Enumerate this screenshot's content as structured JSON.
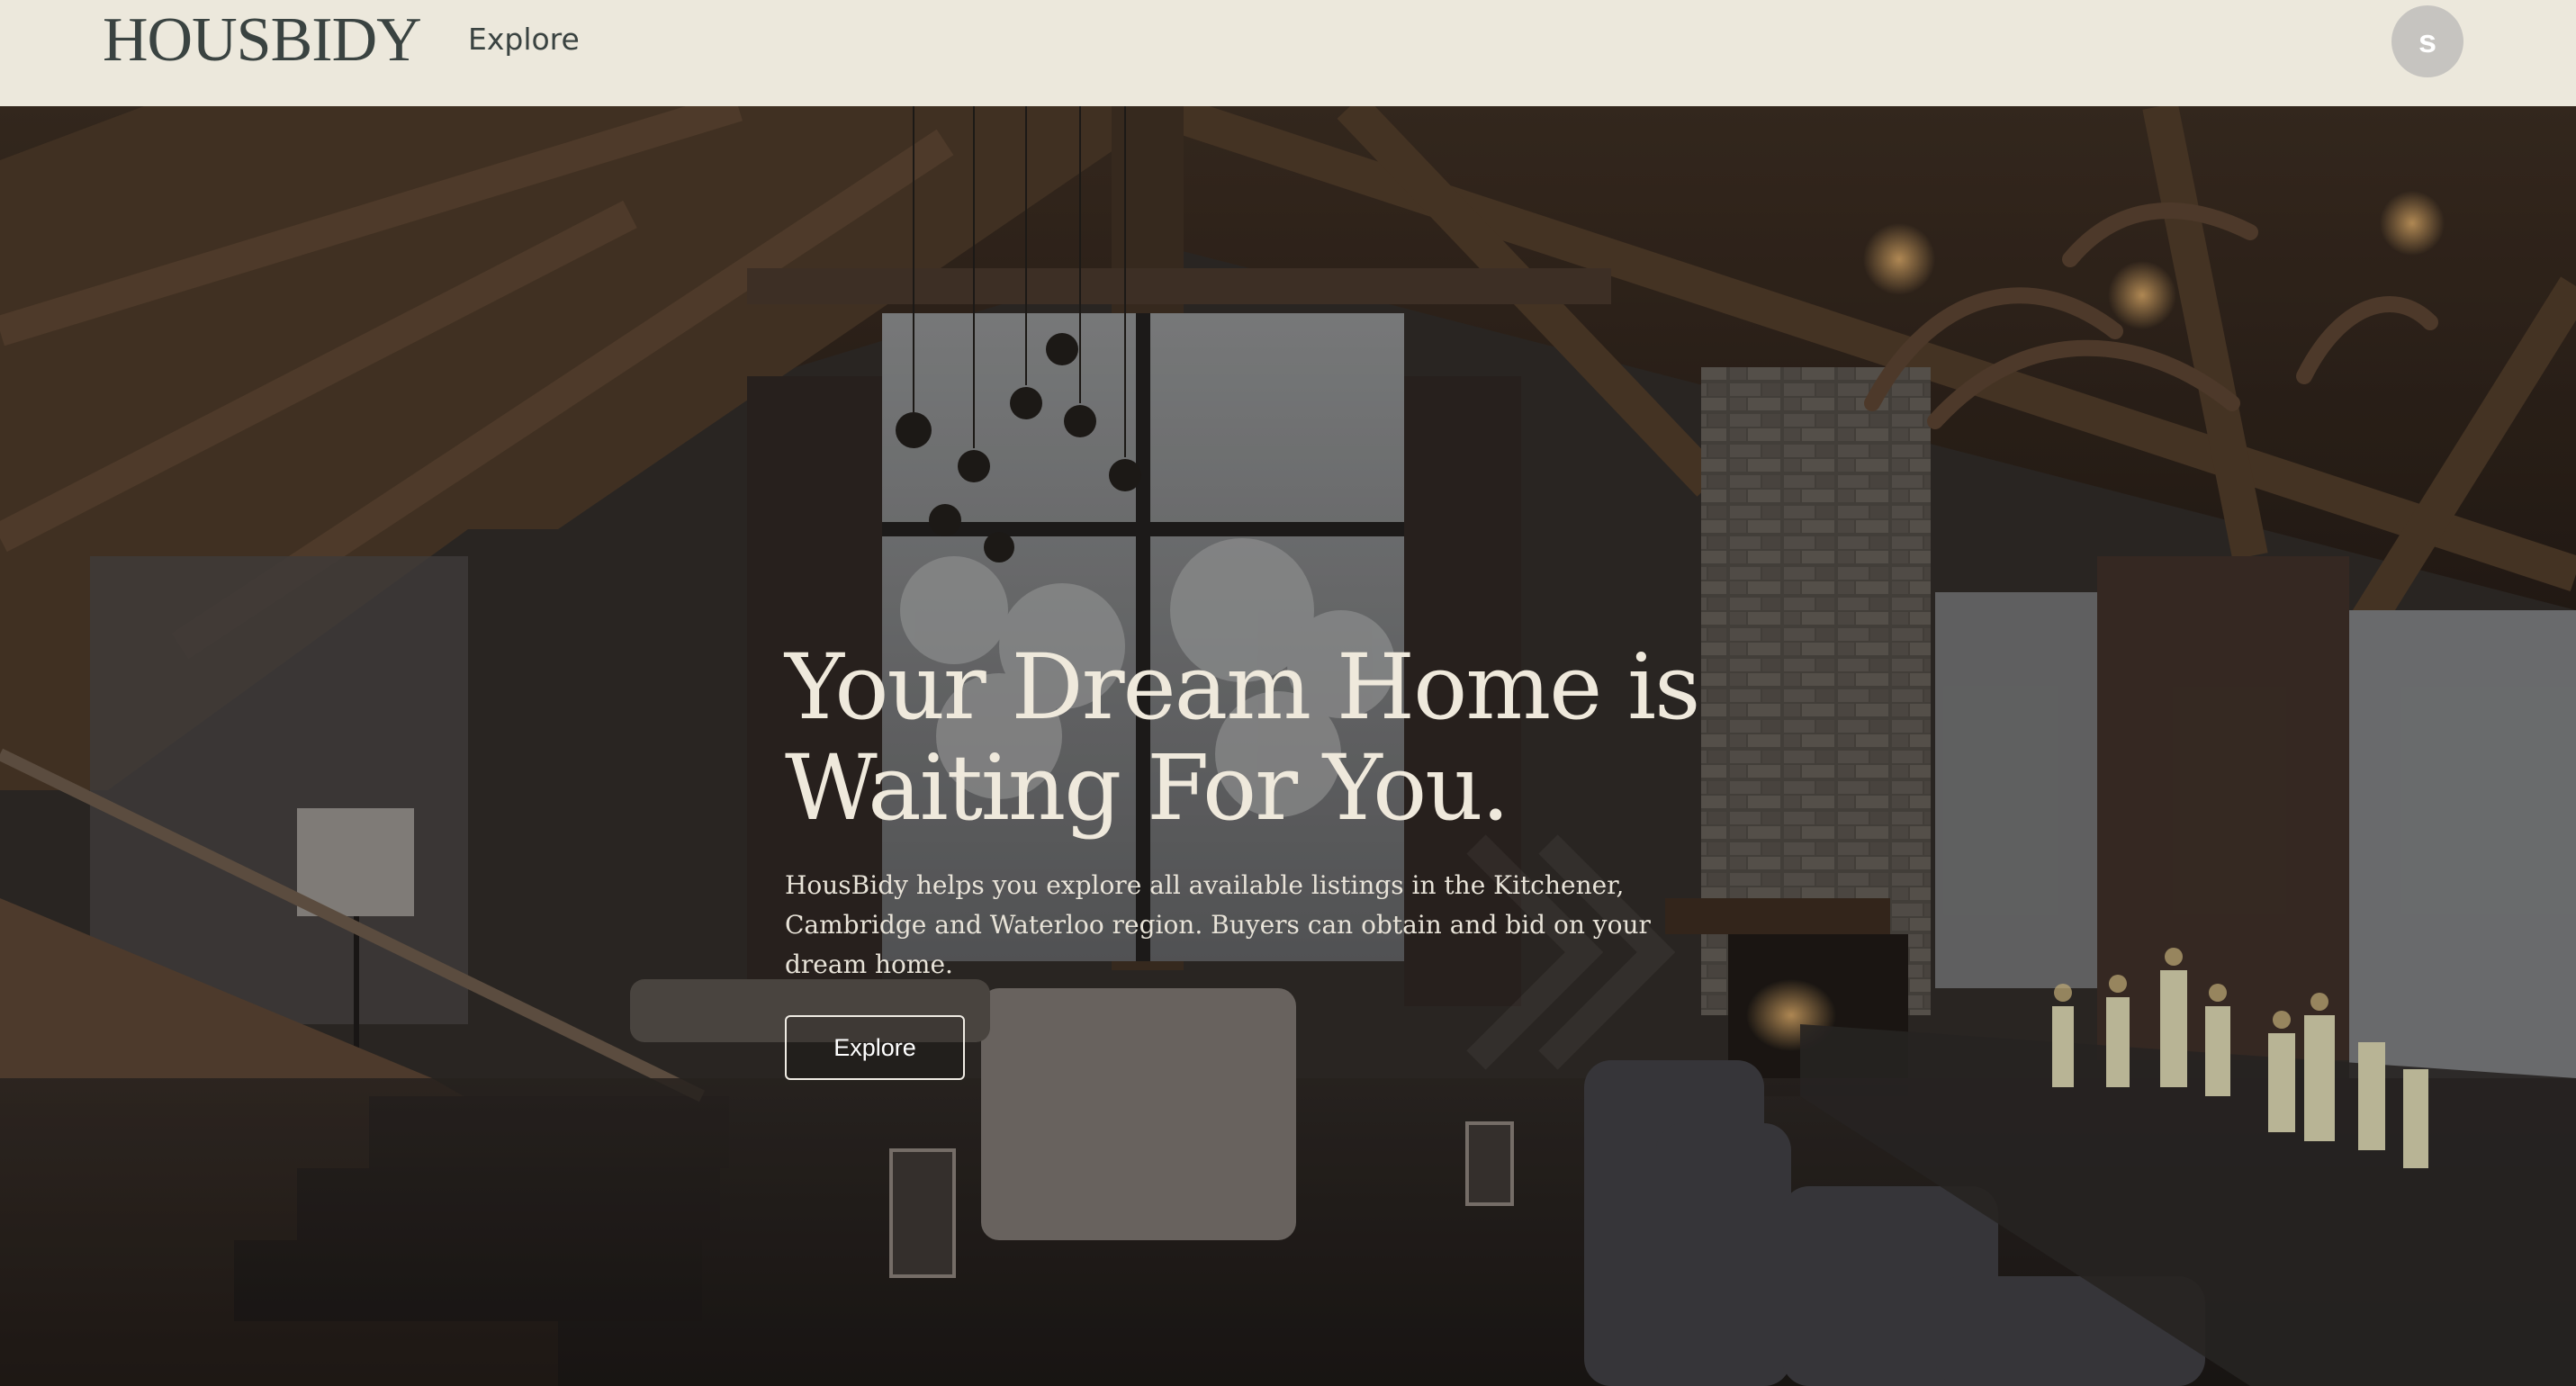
{
  "header": {
    "logo": "HOUSBIDY",
    "nav_explore": "Explore",
    "avatar_initial": "s"
  },
  "hero": {
    "title_line1": "Your Dream Home is",
    "title_line2": "Waiting For You.",
    "description": "HousBidy helps you explore all available listings in the Kitchener, Cambridge and Waterloo region. Buyers can obtain and bid on your dream home.",
    "button_label": "Explore",
    "background_image": "dark-rustic-lodge-interior"
  },
  "colors": {
    "navbar_bg": "#ece8dc",
    "logo_text": "#3a4341",
    "hero_title": "#efe9dc",
    "avatar_bg": "#c6c4c0"
  }
}
